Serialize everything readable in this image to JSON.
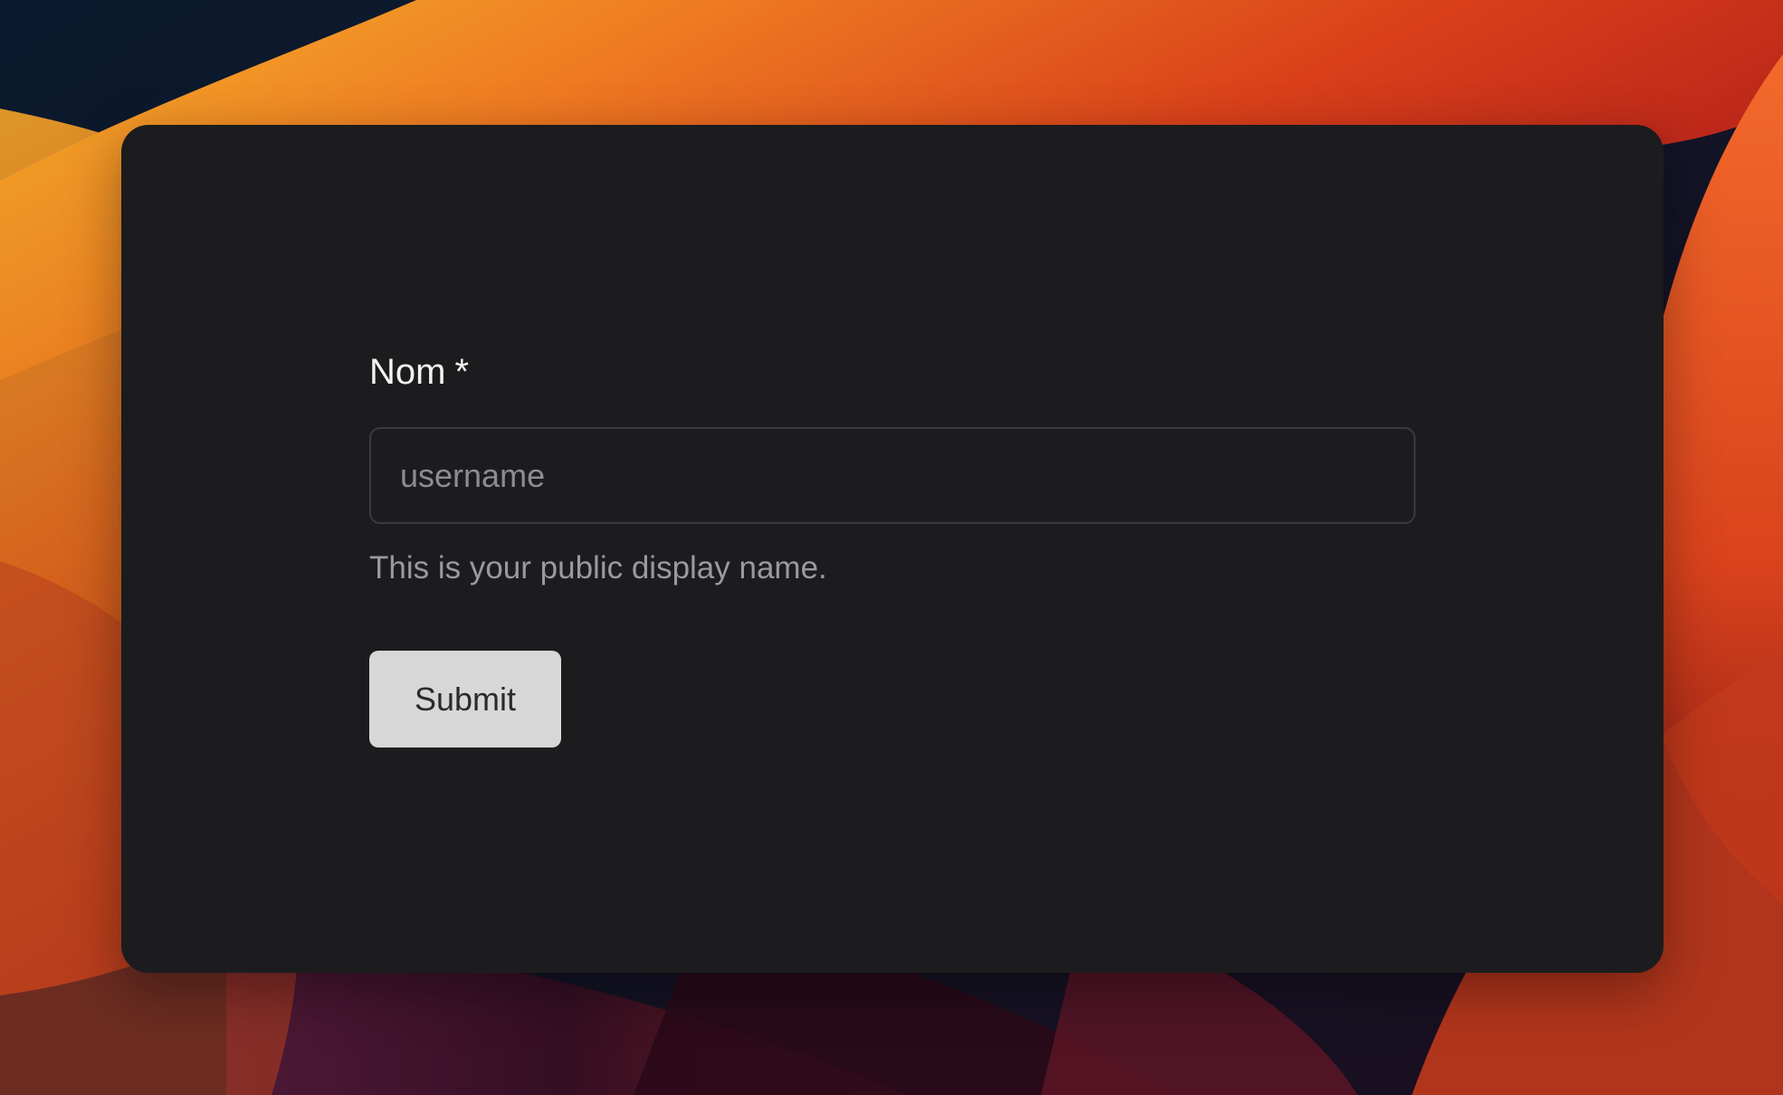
{
  "form": {
    "label": "Nom",
    "required_mark": "*",
    "input_value": "",
    "input_placeholder": "username",
    "hint": "This is your public display name.",
    "submit_label": "Submit"
  },
  "colors": {
    "card_background": "#1c1c1e",
    "button_background": "#d7d7d7",
    "wallpaper_accent": "#e8561f"
  }
}
